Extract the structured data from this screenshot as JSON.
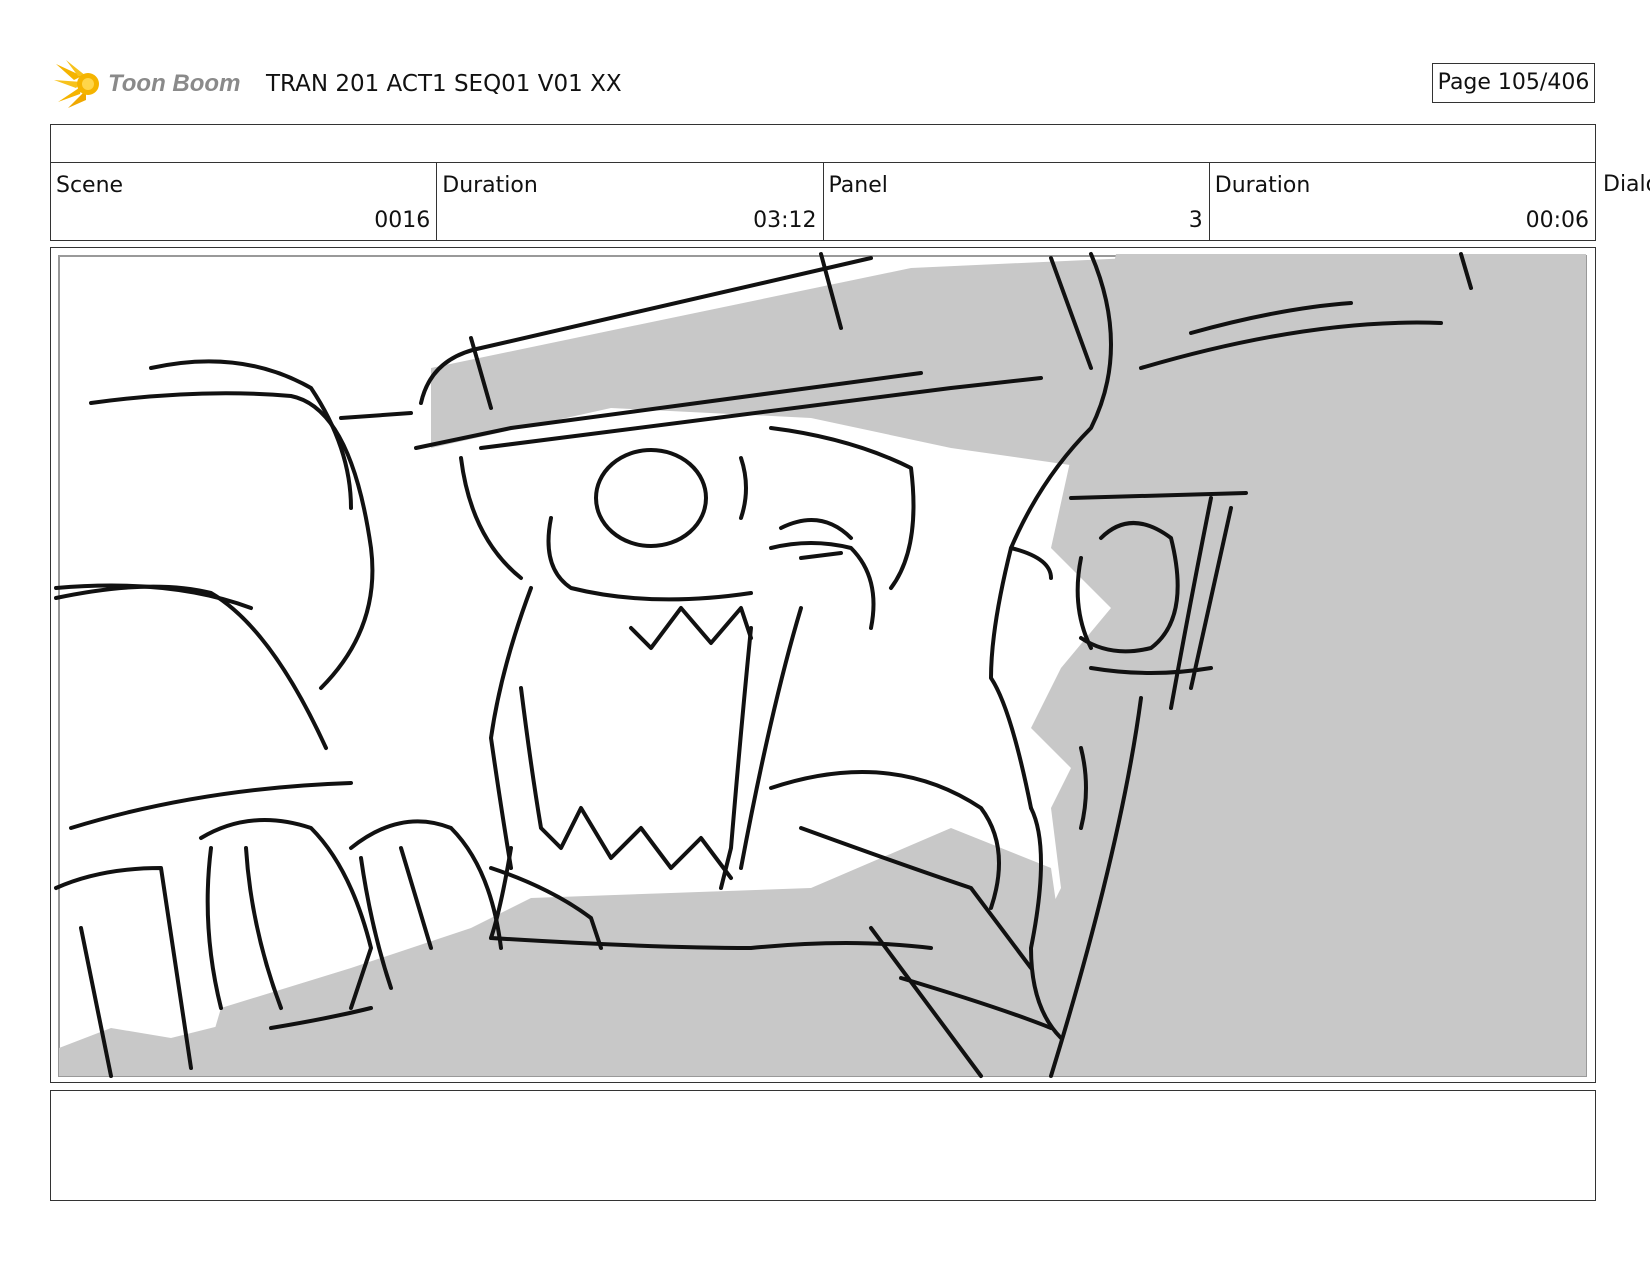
{
  "header": {
    "logo_text": "Toon Boom",
    "document_title": "TRAN 201 ACT1 SEQ01 V01 XX",
    "page_indicator": "Page 105/406"
  },
  "info": {
    "scene_label": "Scene",
    "scene_value": "0016",
    "scene_duration_label": "Duration",
    "scene_duration_value": "03:12",
    "panel_label": "Panel",
    "panel_value": "3",
    "panel_duration_label": "Duration",
    "panel_duration_value": "00:06",
    "dialog_label": "Dialog"
  },
  "colors": {
    "logo_orange": "#f5b400",
    "logo_text": "#8a8a8a",
    "sketch_gray": "#c8c8c8",
    "ink": "#111111"
  },
  "panel_image": "storyboard sketch: two robots, a screaming bearded robot with visor and a larger gray robot at right",
  "notes": {
    "text": ""
  }
}
